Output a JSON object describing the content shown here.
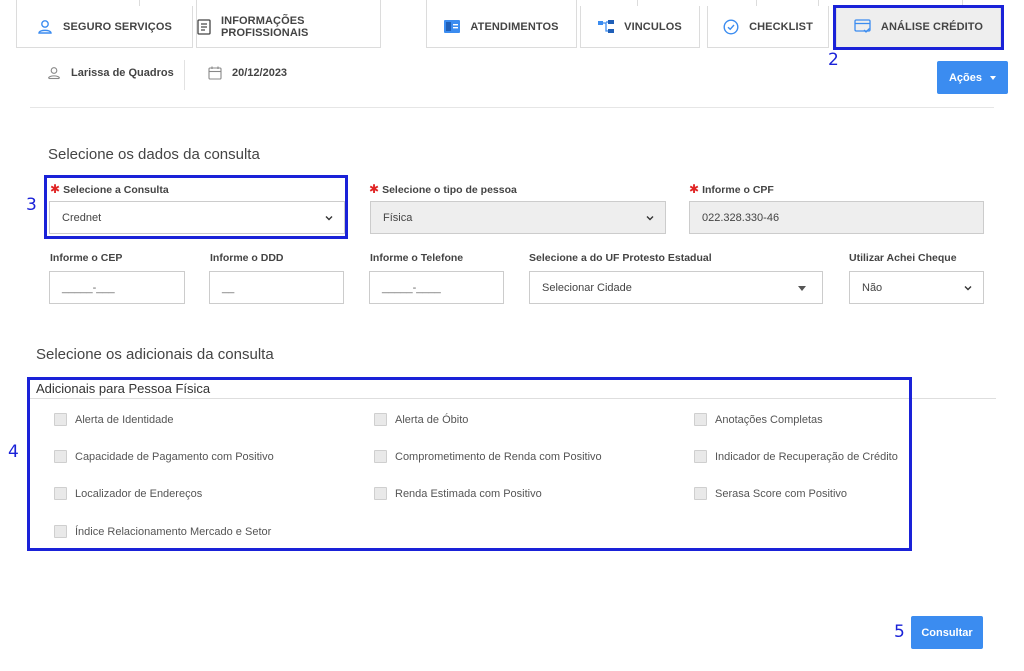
{
  "tabs": [
    {
      "label": "SEGURO SERVIÇOS",
      "icon": "user-icon"
    },
    {
      "label": "INFORMAÇÕES PROFISSIONAIS",
      "icon": "document-icon"
    },
    {
      "label": "ATENDIMENTOS",
      "icon": "panel-icon"
    },
    {
      "label": "VINCULOS",
      "icon": "hierarchy-icon"
    },
    {
      "label": "CHECKLIST",
      "icon": "check-circle-icon"
    },
    {
      "label": "ANÁLISE CRÉDITO",
      "icon": "credit-card-icon",
      "active": true
    }
  ],
  "info": {
    "user_name": "Larissa de Quadros",
    "date": "20/12/2023",
    "actions_label": "Ações"
  },
  "annotations": {
    "a2": "2",
    "a3": "3",
    "a4": "4",
    "a5": "5"
  },
  "consulta": {
    "section_title": "Selecione os dados da consulta",
    "consulta_label": "Selecione a Consulta",
    "consulta_value": "Crednet",
    "tipo_label": "Selecione o tipo de pessoa",
    "tipo_value": "Física",
    "cpf_label": "Informe o CPF",
    "cpf_value": "022.328.330-46",
    "cep_label": "Informe o CEP",
    "cep_placeholder": "_____-___",
    "ddd_label": "Informe o DDD",
    "ddd_placeholder": "__",
    "telefone_label": "Informe o Telefone",
    "telefone_placeholder": "_____-____",
    "uf_label": "Selecione a do UF Protesto Estadual",
    "uf_value": "Selecionar Cidade",
    "achei_label": "Utilizar Achei Cheque",
    "achei_value": "Não"
  },
  "adicionais": {
    "section_title": "Selecione os adicionais da consulta",
    "group_title": "Adicionais para Pessoa Física",
    "items": [
      "Alerta de Identidade",
      "Alerta de Óbito",
      "Anotações Completas",
      "Capacidade de Pagamento com Positivo",
      "Comprometimento de Renda com Positivo",
      "Indicador de Recuperação de Crédito",
      "Localizador de Endereços",
      "Renda Estimada com Positivo",
      "Serasa Score com Positivo",
      "Índice Relacionamento Mercado e Setor"
    ]
  },
  "submit_label": "Consultar",
  "colors": {
    "primary": "#3b8cf0",
    "annotation": "#1a22d8",
    "required": "#e02424"
  }
}
